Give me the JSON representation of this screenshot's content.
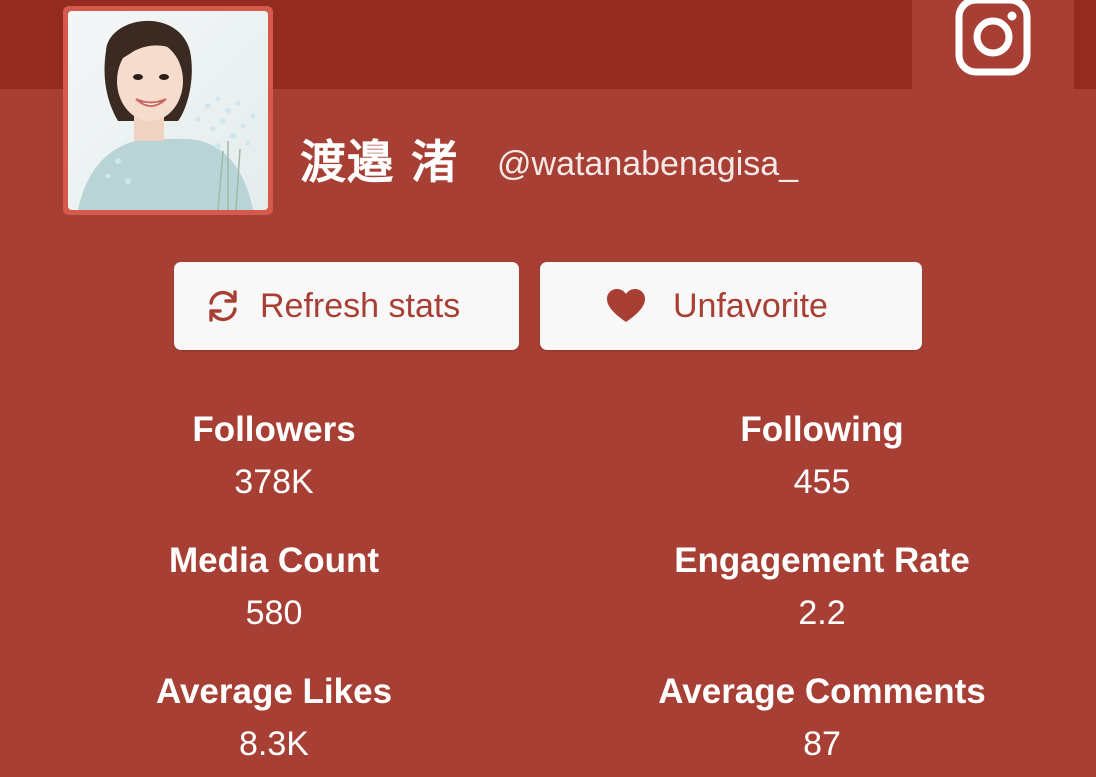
{
  "profile": {
    "display_name": "渡邉 渚",
    "handle": "@watanabenagisa_",
    "avatar_icon": "profile-photo",
    "platform_icon": "instagram-icon"
  },
  "actions": {
    "refresh_label": "Refresh stats",
    "refresh_icon": "refresh-icon",
    "favorite_label": "Unfavorite",
    "favorite_icon": "heart-icon"
  },
  "stats": [
    {
      "label": "Followers",
      "value": "378K"
    },
    {
      "label": "Following",
      "value": "455"
    },
    {
      "label": "Media Count",
      "value": "580"
    },
    {
      "label": "Engagement Rate",
      "value": "2.2"
    },
    {
      "label": "Average Likes",
      "value": "8.3K"
    },
    {
      "label": "Average Comments",
      "value": "87"
    }
  ],
  "colors": {
    "background": "#a83f34",
    "header_band": "#942b21",
    "button_bg": "#f8f8f8",
    "accent": "#a83f34",
    "text": "#ffffff"
  }
}
